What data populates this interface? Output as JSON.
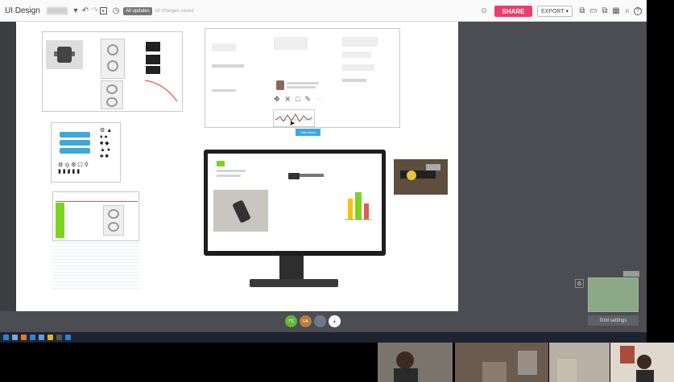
{
  "toolbar": {
    "title": "UI Design",
    "badge_text": "All updates",
    "saved_status": "All changes saved",
    "share_label": "SHARE",
    "export_label": "EXPORT"
  },
  "board": {
    "sticky_label": "Hide Menu",
    "tool_icons": [
      "move-icon",
      "cross-icon",
      "square-icon",
      "pen-icon"
    ]
  },
  "minimap": {
    "grid_button_label": "Grid settings"
  },
  "controls": {
    "avatars": [
      "TS",
      "UA"
    ]
  },
  "colors": {
    "share": "#f03a6e",
    "canvas": "#4b4d52",
    "sticky": "#3ea7e2",
    "green": "#7ed321"
  }
}
